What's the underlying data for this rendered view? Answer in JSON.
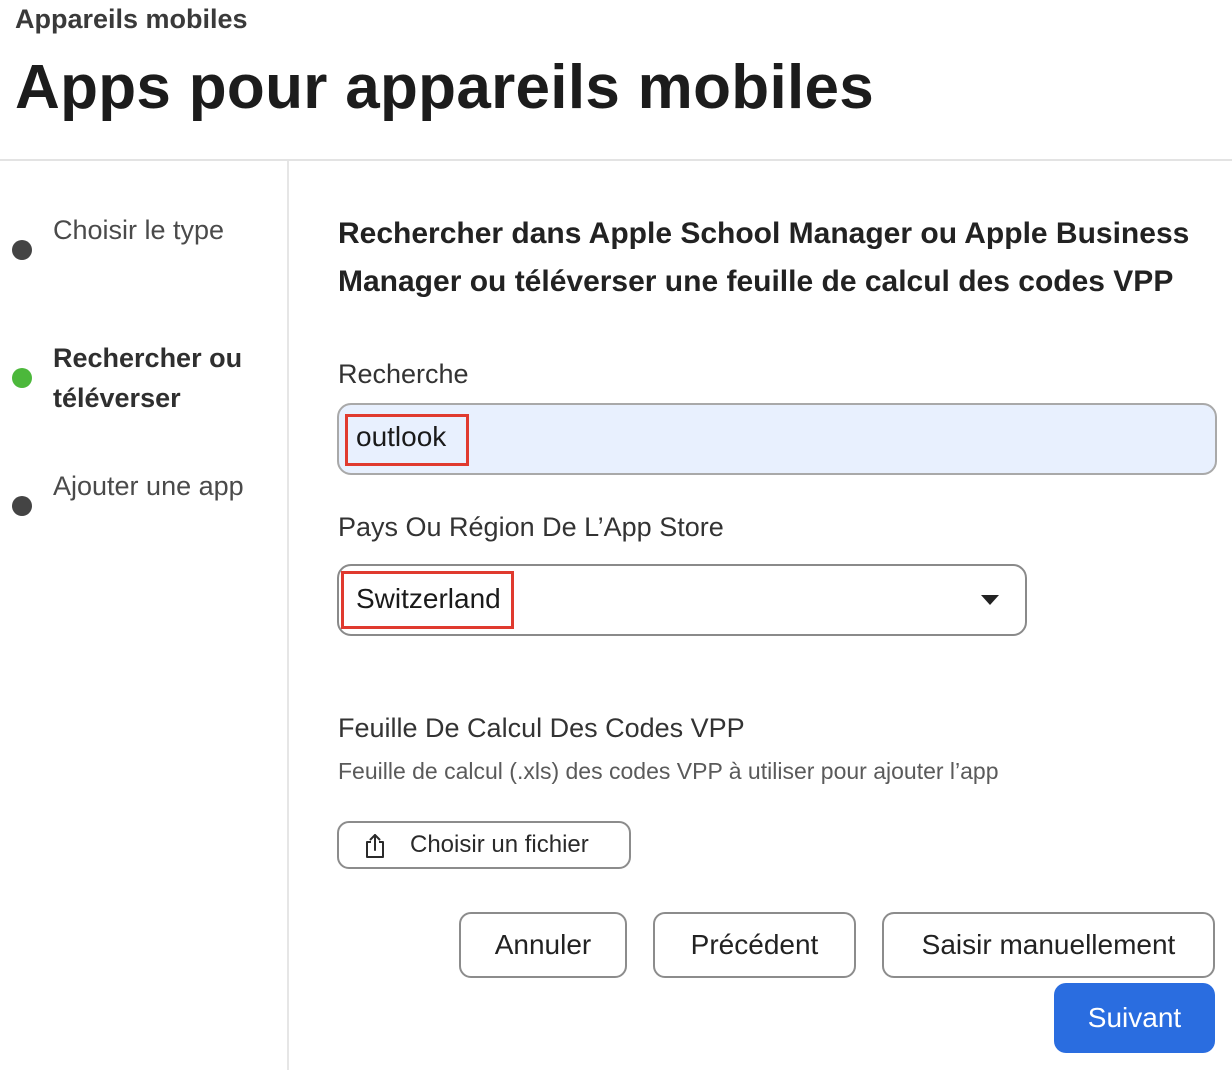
{
  "header": {
    "breadcrumb": "Appareils mobiles",
    "title": "Apps pour appareils mobiles"
  },
  "steps": [
    {
      "label": "Choisir le type",
      "state": "done"
    },
    {
      "label": "Rechercher ou téléverser",
      "state": "active"
    },
    {
      "label": "Ajouter une app",
      "state": "pending"
    }
  ],
  "main": {
    "heading": "Rechercher dans Apple School Manager ou Apple Business Manager ou téléverser une feuille de calcul des codes VPP",
    "search": {
      "label": "Recherche",
      "value": "outlook"
    },
    "country": {
      "label": "Pays Ou Région De L’App Store",
      "value": "Switzerland"
    },
    "spreadsheet": {
      "label": "Feuille De Calcul Des Codes VPP",
      "helper": "Feuille de calcul (.xls) des codes VPP à utiliser pour ajouter l’app",
      "button_label": "Choisir un fichier"
    }
  },
  "actions": {
    "cancel": "Annuler",
    "previous": "Précédent",
    "manual": "Saisir manuellement",
    "next": "Suivant"
  },
  "colors": {
    "accent": "#2a6de0",
    "active_step": "#4cb83b",
    "highlight": "#e03a2f",
    "input_fill": "#e8f0fe"
  }
}
